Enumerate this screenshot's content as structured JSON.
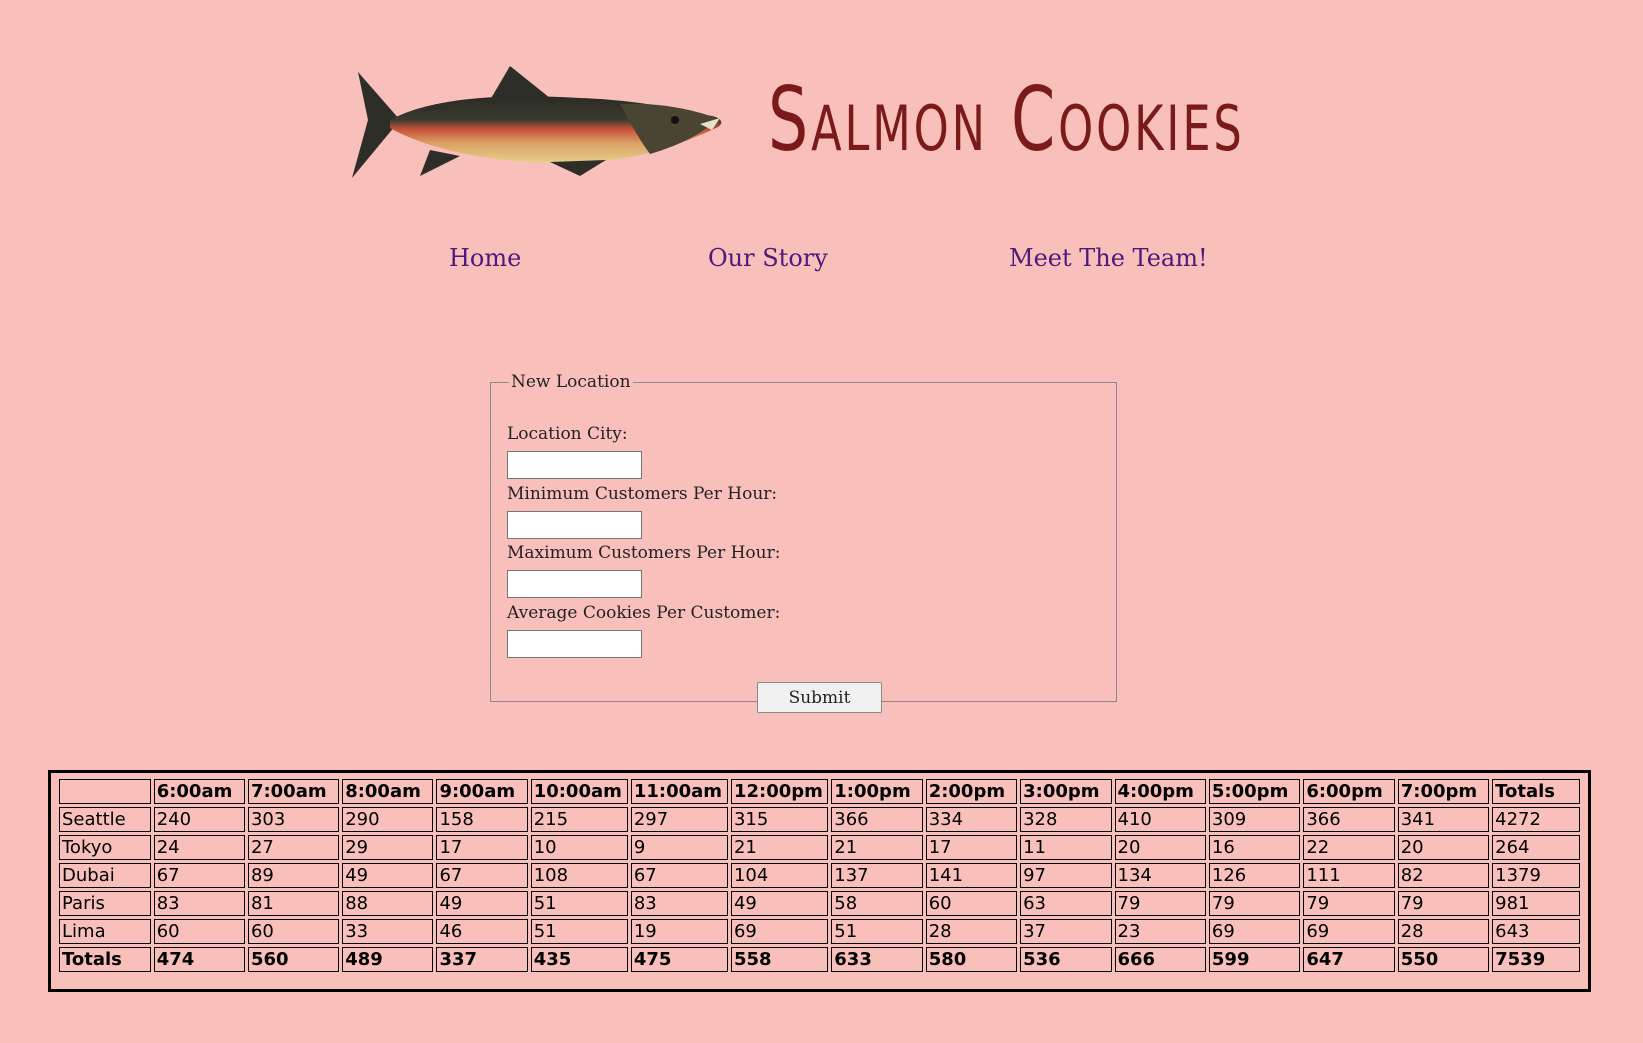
{
  "header": {
    "title": "Salmon Cookies",
    "logo_icon": "salmon-fish-icon"
  },
  "nav": {
    "items": [
      {
        "label": "Home"
      },
      {
        "label": "Our Story"
      },
      {
        "label": "Meet The Team!"
      }
    ],
    "link_color": "#4b1a7a"
  },
  "form": {
    "legend": "New Location",
    "fields": [
      {
        "label": "Location City:",
        "value": ""
      },
      {
        "label": "Minimum Customers Per Hour:",
        "value": ""
      },
      {
        "label": "Maximum Customers Per Hour:",
        "value": ""
      },
      {
        "label": "Average Cookies Per Customer:",
        "value": ""
      }
    ],
    "submit_label": "Submit"
  },
  "table": {
    "headers": [
      "",
      "6:00am",
      "7:00am",
      "8:00am",
      "9:00am",
      "10:00am",
      "11:00am",
      "12:00pm",
      "1:00pm",
      "2:00pm",
      "3:00pm",
      "4:00pm",
      "5:00pm",
      "6:00pm",
      "7:00pm",
      "Totals"
    ],
    "rows": [
      [
        "Seattle",
        "240",
        "303",
        "290",
        "158",
        "215",
        "297",
        "315",
        "366",
        "334",
        "328",
        "410",
        "309",
        "366",
        "341",
        "4272"
      ],
      [
        "Tokyo",
        "24",
        "27",
        "29",
        "17",
        "10",
        "9",
        "21",
        "21",
        "17",
        "11",
        "20",
        "16",
        "22",
        "20",
        "264"
      ],
      [
        "Dubai",
        "67",
        "89",
        "49",
        "67",
        "108",
        "67",
        "104",
        "137",
        "141",
        "97",
        "134",
        "126",
        "111",
        "82",
        "1379"
      ],
      [
        "Paris",
        "83",
        "81",
        "88",
        "49",
        "51",
        "83",
        "49",
        "58",
        "60",
        "63",
        "79",
        "79",
        "79",
        "79",
        "981"
      ],
      [
        "Lima",
        "60",
        "60",
        "33",
        "46",
        "51",
        "19",
        "69",
        "51",
        "28",
        "37",
        "23",
        "69",
        "69",
        "28",
        "643"
      ]
    ],
    "totals": [
      "Totals",
      "474",
      "560",
      "489",
      "337",
      "435",
      "475",
      "558",
      "633",
      "580",
      "536",
      "666",
      "599",
      "647",
      "550",
      "7539"
    ]
  },
  "colors": {
    "background": "#f9bfbb",
    "title": "#7a1a1a"
  }
}
